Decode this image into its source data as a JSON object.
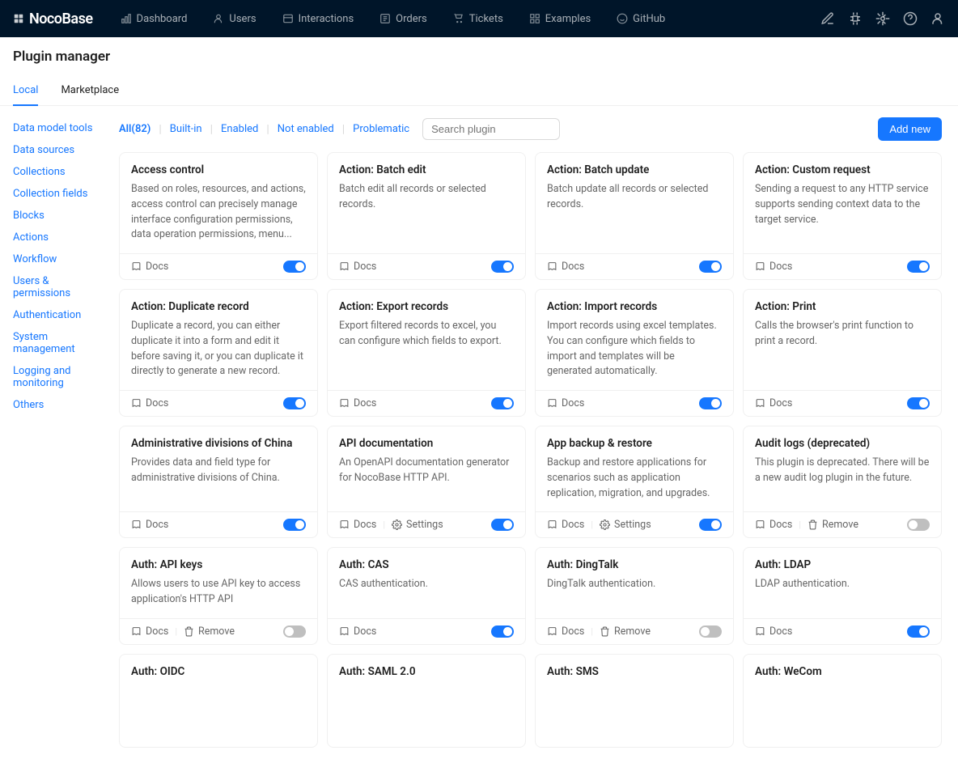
{
  "logo": "NocoBase",
  "nav": [
    {
      "label": "Dashboard"
    },
    {
      "label": "Users"
    },
    {
      "label": "Interactions"
    },
    {
      "label": "Orders"
    },
    {
      "label": "Tickets"
    },
    {
      "label": "Examples"
    },
    {
      "label": "GitHub"
    }
  ],
  "page_title": "Plugin manager",
  "tabs": [
    {
      "label": "Local",
      "active": true
    },
    {
      "label": "Marketplace",
      "active": false
    }
  ],
  "sidebar": [
    "Data model tools",
    "Data sources",
    "Collections",
    "Collection fields",
    "Blocks",
    "Actions",
    "Workflow",
    "Users & permissions",
    "Authentication",
    "System management",
    "Logging and monitoring",
    "Others"
  ],
  "filters": [
    {
      "label": "All(82)",
      "active": true
    },
    {
      "label": "Built-in"
    },
    {
      "label": "Enabled"
    },
    {
      "label": "Not enabled"
    },
    {
      "label": "Problematic"
    }
  ],
  "search_placeholder": "Search plugin",
  "add_button": "Add new",
  "labels": {
    "docs": "Docs",
    "settings": "Settings",
    "remove": "Remove"
  },
  "plugins": [
    {
      "title": "Access control",
      "desc": "Based on roles, resources, and actions, access control can precisely manage interface configuration permissions, data operation permissions, menu...",
      "actions": [
        "docs"
      ],
      "on": true
    },
    {
      "title": "Action: Batch edit",
      "desc": "Batch edit all records or selected records.",
      "actions": [
        "docs"
      ],
      "on": true
    },
    {
      "title": "Action: Batch update",
      "desc": "Batch update all records or selected records.",
      "actions": [
        "docs"
      ],
      "on": true
    },
    {
      "title": "Action: Custom request",
      "desc": "Sending a request to any HTTP service supports sending context data to the target service.",
      "actions": [
        "docs"
      ],
      "on": true
    },
    {
      "title": "Action: Duplicate record",
      "desc": "Duplicate a record, you can either duplicate it into a form and edit it before saving it, or you can duplicate it directly to generate a new record.",
      "actions": [
        "docs"
      ],
      "on": true
    },
    {
      "title": "Action: Export records",
      "desc": "Export filtered records to excel, you can configure which fields to export.",
      "actions": [
        "docs"
      ],
      "on": true
    },
    {
      "title": "Action: Import records",
      "desc": "Import records using excel templates. You can configure which fields to import and templates will be generated automatically.",
      "actions": [
        "docs"
      ],
      "on": true
    },
    {
      "title": "Action: Print",
      "desc": "Calls the browser's print function to print a record.",
      "actions": [
        "docs"
      ],
      "on": true
    },
    {
      "title": "Administrative divisions of China",
      "desc": "Provides data and field type for administrative divisions of China.",
      "actions": [
        "docs"
      ],
      "on": true
    },
    {
      "title": "API documentation",
      "desc": "An OpenAPI documentation generator for NocoBase HTTP API.",
      "actions": [
        "docs",
        "settings"
      ],
      "on": true
    },
    {
      "title": "App backup & restore",
      "desc": "Backup and restore applications for scenarios such as application replication, migration, and upgrades.",
      "actions": [
        "docs",
        "settings"
      ],
      "on": true
    },
    {
      "title": "Audit logs (deprecated)",
      "desc": "This plugin is deprecated. There will be a new audit log plugin in the future.",
      "actions": [
        "docs",
        "remove"
      ],
      "on": false
    },
    {
      "title": "Auth: API keys",
      "desc": "Allows users to use API key to access application's HTTP API",
      "actions": [
        "docs",
        "remove"
      ],
      "on": false
    },
    {
      "title": "Auth: CAS",
      "desc": "CAS authentication.",
      "actions": [
        "docs"
      ],
      "on": true
    },
    {
      "title": "Auth: DingTalk",
      "desc": "DingTalk authentication.",
      "actions": [
        "docs",
        "remove"
      ],
      "on": false
    },
    {
      "title": "Auth: LDAP",
      "desc": "LDAP authentication.",
      "actions": [
        "docs"
      ],
      "on": true
    },
    {
      "title": "Auth: OIDC",
      "desc": "",
      "actions": [],
      "on": null
    },
    {
      "title": "Auth: SAML 2.0",
      "desc": "",
      "actions": [],
      "on": null
    },
    {
      "title": "Auth: SMS",
      "desc": "",
      "actions": [],
      "on": null
    },
    {
      "title": "Auth: WeCom",
      "desc": "",
      "actions": [],
      "on": null
    }
  ]
}
